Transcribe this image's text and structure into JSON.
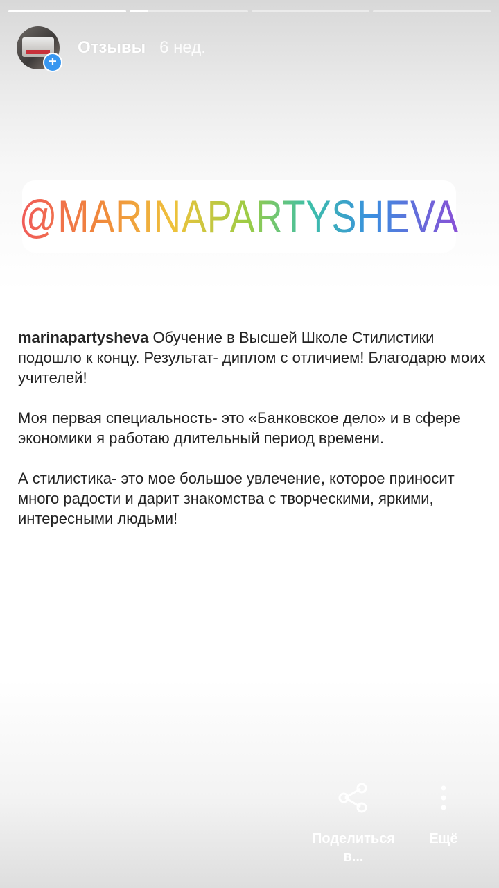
{
  "progress": {
    "segments": [
      1,
      0.15,
      0,
      0
    ]
  },
  "header": {
    "account_name": "Отзывы",
    "time_ago": "6 нед."
  },
  "sticker": {
    "text": "@MARINAPARTYSHEVA"
  },
  "caption": {
    "username": "marinapartysheva",
    "paragraph1": " Обучение в Высшей Школе Стилистики подошло к концу. Результат- диплом с отличием! Благодарю моих учителей!",
    "paragraph2": "Моя первая  специальность- это «Банковское дело» и в сфере экономики я работаю длительный период времени.",
    "paragraph3": "А стилистика- это мое большое увлечение, которое приносит много радости и дарит знакомства с творческими, яркими, интересными  людьми!"
  },
  "actions": {
    "share_label": "Поделиться в...",
    "more_label": "Ещё",
    "share_icon": "share-icon",
    "more_icon": "more-vertical-icon"
  },
  "colors": {
    "plus_badge": "#3897f0",
    "gradient": [
      "#f05a5a",
      "#f0873c",
      "#efc23c",
      "#9ccc45",
      "#3dbfa8",
      "#3a8fe0",
      "#8a4fd6"
    ]
  }
}
